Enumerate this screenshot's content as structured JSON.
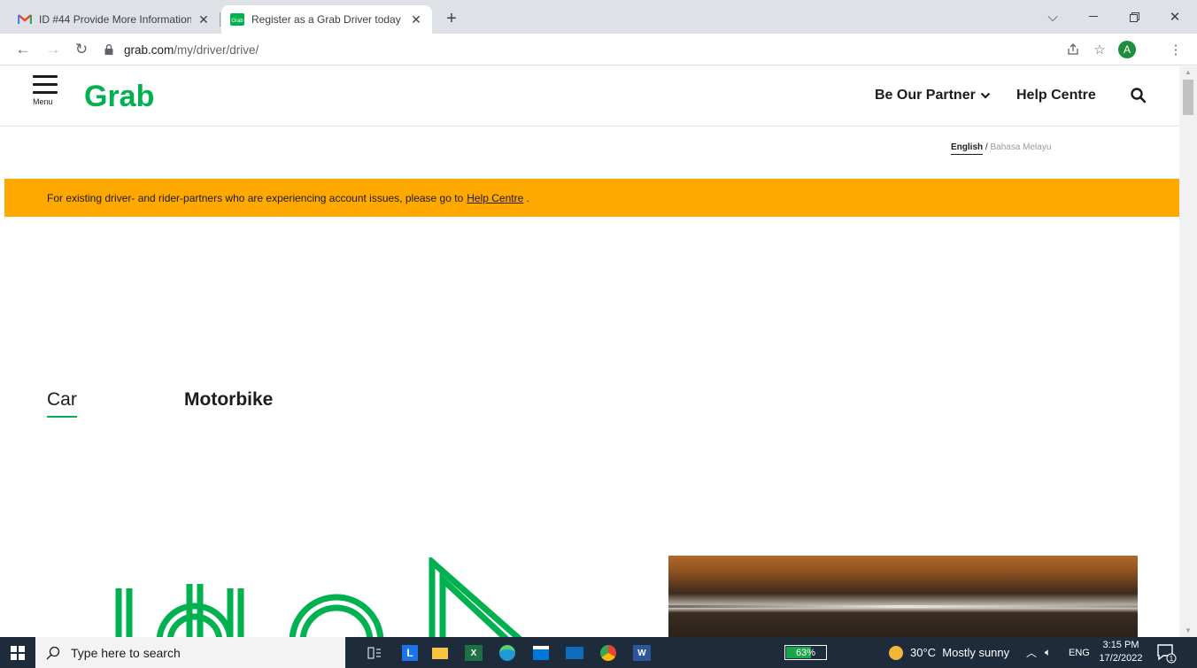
{
  "browser": {
    "tabs": [
      {
        "title": "ID #44 Provide More Information",
        "favicon": "gmail-icon",
        "active": false
      },
      {
        "title": "Register as a Grab Driver today | C",
        "favicon": "grab-favicon",
        "active": true
      }
    ],
    "new_tab": "+",
    "address": {
      "host": "grab.com",
      "path": "/my/driver/drive/"
    },
    "profile_initial": "A"
  },
  "header": {
    "menu_label": "Menu",
    "logo_text": "Grab",
    "nav": {
      "partner": "Be Our Partner",
      "help": "Help Centre"
    }
  },
  "language": {
    "english": "English",
    "separator": " / ",
    "malay": "Bahasa Melayu"
  },
  "notice": {
    "text": "For existing driver- and rider-partners who are experiencing account issues, please go to",
    "link": "Help Centre",
    "suffix": " ."
  },
  "vehicle_tabs": {
    "car": "Car",
    "motorbike": "Motorbike"
  },
  "taskbar": {
    "search_placeholder": "Type here to search",
    "battery": "63%",
    "battery_level": 0.63,
    "weather": "30°C  Mostly sunny",
    "lang": "ENG",
    "time": "3:15 PM",
    "date": "17/2/2022",
    "notification_count": "1"
  },
  "colors": {
    "brand_green": "#00b14f",
    "notice_bg": "#ffa800",
    "taskbar_bg": "#1d2b3a"
  }
}
